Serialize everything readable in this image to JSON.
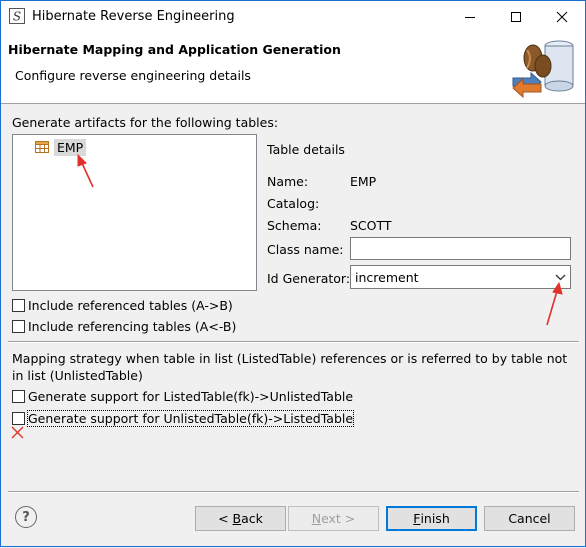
{
  "window": {
    "title": "Hibernate Reverse Engineering"
  },
  "banner": {
    "title": "Hibernate Mapping and Application Generation",
    "subtitle": "Configure reverse engineering details"
  },
  "tables_section": {
    "label": "Generate artifacts for the following tables:",
    "items": [
      {
        "name": "EMP",
        "icon": "table-icon"
      }
    ]
  },
  "details": {
    "heading": "Table details",
    "catalog_label": "Catalog:",
    "catalog_value": "",
    "name_label": "Name:",
    "name_value": "EMP",
    "schema_label": "Schema:",
    "schema_value": "SCOTT",
    "class_name_label": "Class name:",
    "class_name_value": "",
    "id_generator_label": "Id Generator:",
    "id_generator_value": "increment"
  },
  "options": {
    "include_referenced": "Include referenced tables (A->B)",
    "include_referencing": "Include referencing tables (A<-B)"
  },
  "mapping": {
    "description": "Mapping strategy when table in list (ListedTable) references or is referred to by table not in list (UnlistedTable)",
    "listed_to_unlisted": "Generate support for ListedTable(fk)->UnlistedTable",
    "unlisted_to_listed": "Generate support for UnlistedTable(fk)->ListedTable"
  },
  "buttons": {
    "help": "?",
    "back_mnemonic": "B",
    "back_rest": "ack",
    "back_prefix": "< ",
    "next_mnemonic": "N",
    "next_rest": "ext >",
    "finish_mnemonic": "F",
    "finish_rest": "inish",
    "cancel": "Cancel"
  },
  "colors": {
    "accent": "#0078d7",
    "annotation": "#e0302a",
    "window_border": "#1c6fd0"
  }
}
